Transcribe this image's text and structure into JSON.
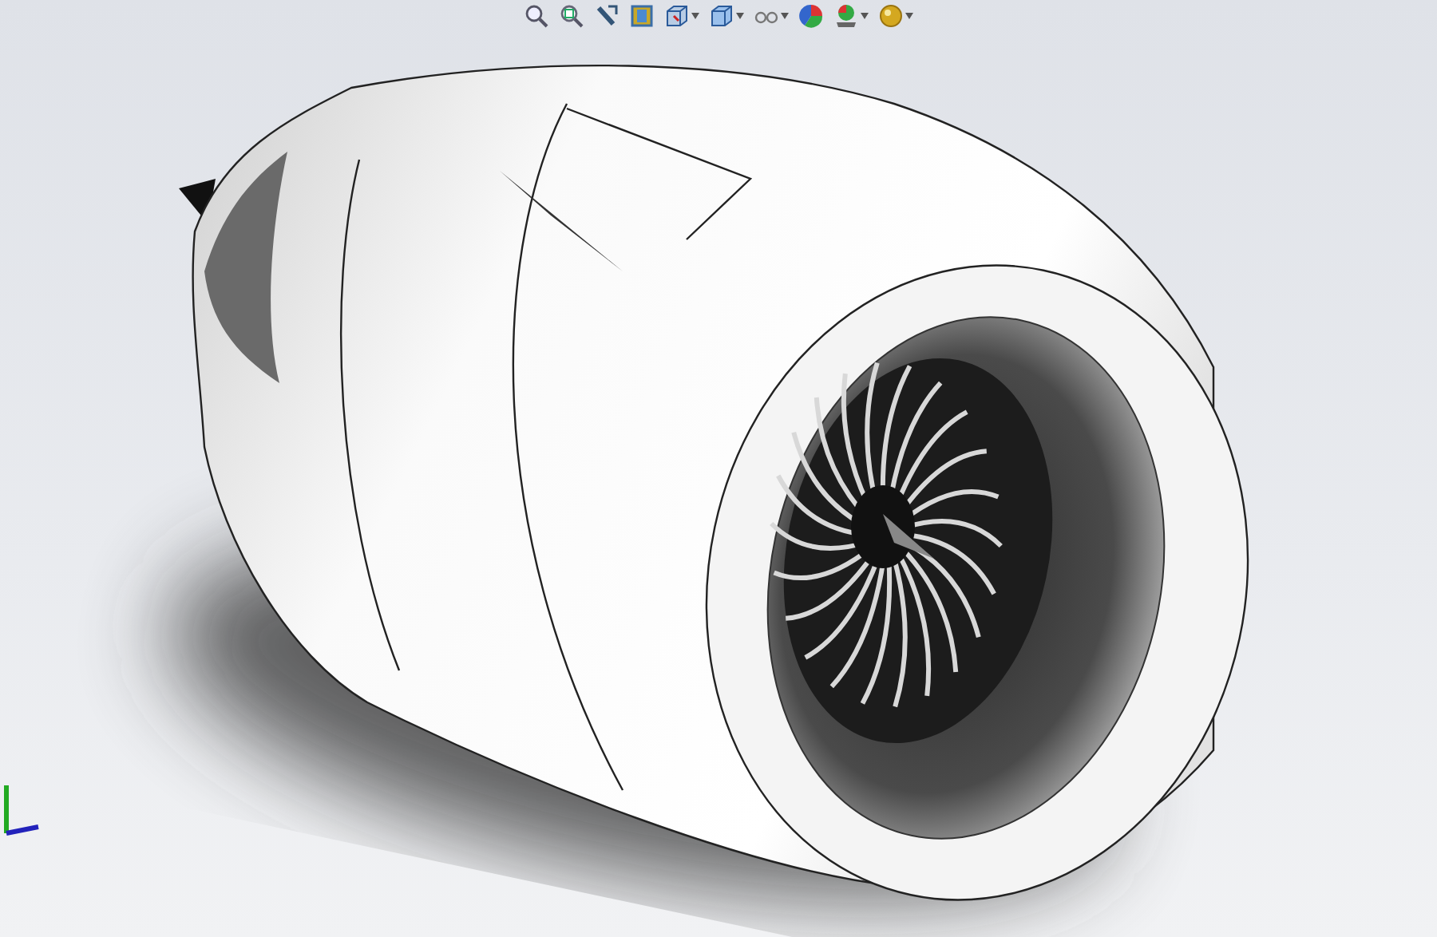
{
  "toolbar": [
    {
      "kind": "zoom-fit",
      "dropdown": false
    },
    {
      "kind": "zoom-area",
      "dropdown": false
    },
    {
      "kind": "previous-view",
      "dropdown": false
    },
    {
      "kind": "section-view",
      "dropdown": false
    },
    {
      "kind": "view-orientation",
      "dropdown": true
    },
    {
      "kind": "display-style",
      "dropdown": true
    },
    {
      "kind": "hide-show",
      "dropdown": true
    },
    {
      "kind": "edit-appearance",
      "dropdown": false
    },
    {
      "kind": "scene",
      "dropdown": true
    },
    {
      "kind": "view-settings",
      "dropdown": true
    }
  ]
}
